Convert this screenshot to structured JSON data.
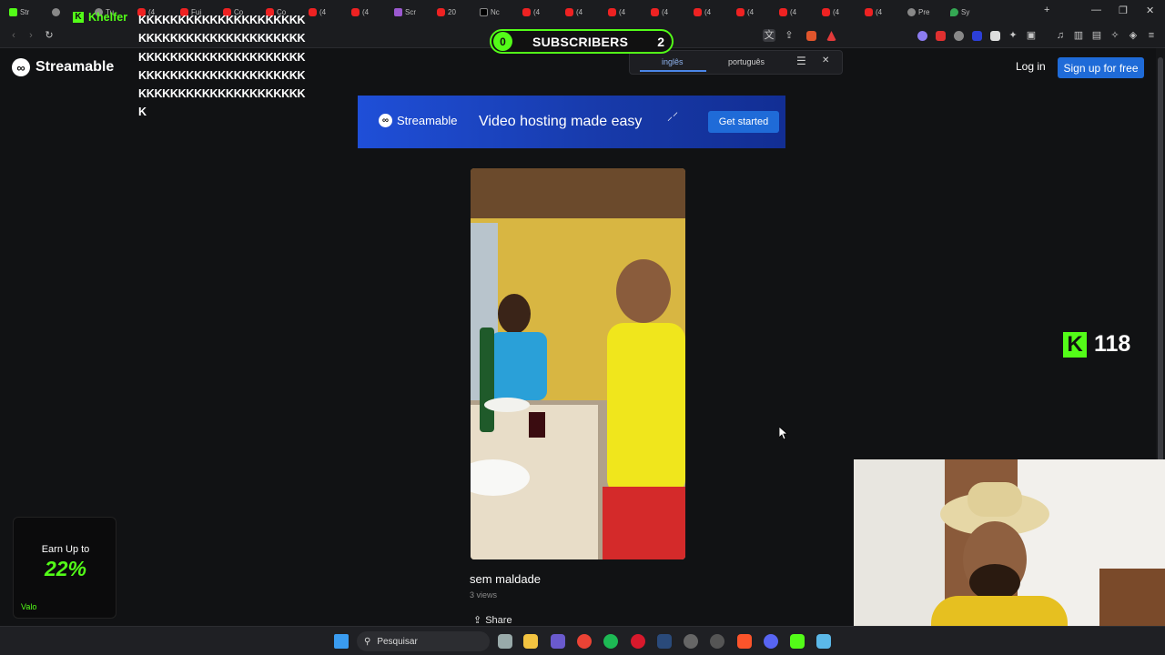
{
  "tabs": [
    {
      "label": "Str",
      "icon": "kick-icon"
    },
    {
      "label": "",
      "icon": "audio-icon"
    },
    {
      "label": "Tu",
      "icon": "generic-icon"
    },
    {
      "label": "(4",
      "icon": "youtube-icon"
    },
    {
      "label": "Fui",
      "icon": "youtube-icon"
    },
    {
      "label": "Co",
      "icon": "youtube-icon"
    },
    {
      "label": "Co",
      "icon": "youtube-icon"
    },
    {
      "label": "(4",
      "icon": "youtube-icon"
    },
    {
      "label": "(4",
      "icon": "youtube-icon"
    },
    {
      "label": "Scr",
      "icon": "pen-icon"
    },
    {
      "label": "20",
      "icon": "youtube-icon"
    },
    {
      "label": "Nc",
      "icon": "x-icon"
    },
    {
      "label": "(4",
      "icon": "youtube-icon"
    },
    {
      "label": "(4",
      "icon": "youtube-icon"
    },
    {
      "label": "(4",
      "icon": "youtube-icon"
    },
    {
      "label": "(4",
      "icon": "youtube-icon"
    },
    {
      "label": "(4",
      "icon": "youtube-icon"
    },
    {
      "label": "(4",
      "icon": "youtube-icon"
    },
    {
      "label": "(4",
      "icon": "youtube-icon"
    },
    {
      "label": "(4",
      "icon": "youtube-icon"
    },
    {
      "label": "(4",
      "icon": "youtube-icon"
    },
    {
      "label": "Pre",
      "icon": "generic-icon"
    },
    {
      "label": "Sy",
      "icon": "maps-icon"
    }
  ],
  "site": {
    "brand": "Streamable",
    "login": "Log in",
    "signup": "Sign up for free"
  },
  "banner": {
    "brand": "Streamable",
    "tagline": "Video hosting made easy",
    "cta": "Get started"
  },
  "video": {
    "title": "sem maldade",
    "views": "3 views",
    "share": "Share"
  },
  "translate": {
    "lang_from": "inglês",
    "lang_to": "português"
  },
  "overlay": {
    "chat_user": "Khelfer",
    "chat_message": "KKKKKKKKKKKKKKKKKKKKKKKKKKKKKKKKKKKKKKKKKKKKKKKKKKKKKKKKKKKKKKKKKKKKKKKKKKKKKKKKKKKKKKKKKKKKKKKKKKKKKKKKKK",
    "subscribers_left": "0",
    "subscribers_label": "SUBSCRIBERS",
    "subscribers_right": "2",
    "kick_viewers": "118",
    "earn_title": "Earn Up to",
    "earn_percent": "22%",
    "earn_brand": "Valo"
  },
  "taskbar": {
    "search_placeholder": "Pesquisar"
  },
  "colors": {
    "kick_green": "#53fc18",
    "streamable_blue": "#1f6bd8",
    "page_bg": "#111214"
  }
}
